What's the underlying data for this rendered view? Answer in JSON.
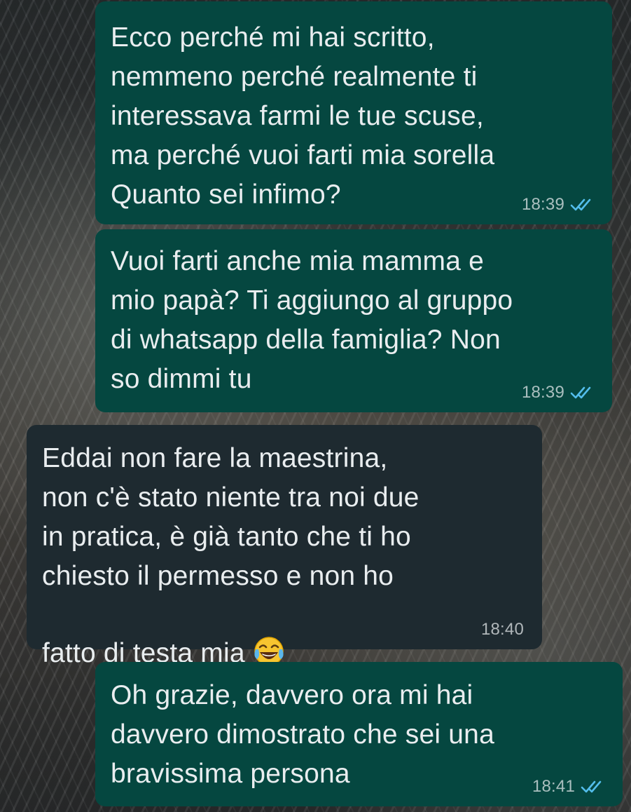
{
  "messages": [
    {
      "direction": "outgoing",
      "text": "Ecco perché mi hai scritto,\nnemmeno perché realmente ti\ninteressava farmi le tue scuse,\nma perché vuoi farti mia sorella\nQuanto sei infimo?",
      "time": "18:39",
      "status": "read",
      "tick_icon": "double-check-icon"
    },
    {
      "direction": "outgoing",
      "text": "Vuoi farti anche mia mamma e\nmio papà? Ti aggiungo al gruppo\ndi whatsapp della famiglia? Non\nso dimmi tu",
      "time": "18:39",
      "status": "read",
      "tick_icon": "double-check-icon"
    },
    {
      "direction": "incoming",
      "text": "Eddai non fare la maestrina,\nnon c'è stato niente tra noi due\nin pratica, è già tanto che ti ho\nchiesto il permesso e non ho\nfatto di testa mia",
      "emoji": "tears-of-joy-emoji",
      "time": "18:40"
    },
    {
      "direction": "outgoing",
      "text": "Oh grazie, davvero ora mi hai\ndavvero dimostrato che sei una\nbravissima persona",
      "time": "18:41",
      "status": "read",
      "tick_icon": "double-check-icon"
    }
  ],
  "colors": {
    "outgoing_bubble": "#054740",
    "incoming_bubble": "#1e2a30",
    "text": "#e9edef",
    "read_ticks": "#53bdeb"
  }
}
